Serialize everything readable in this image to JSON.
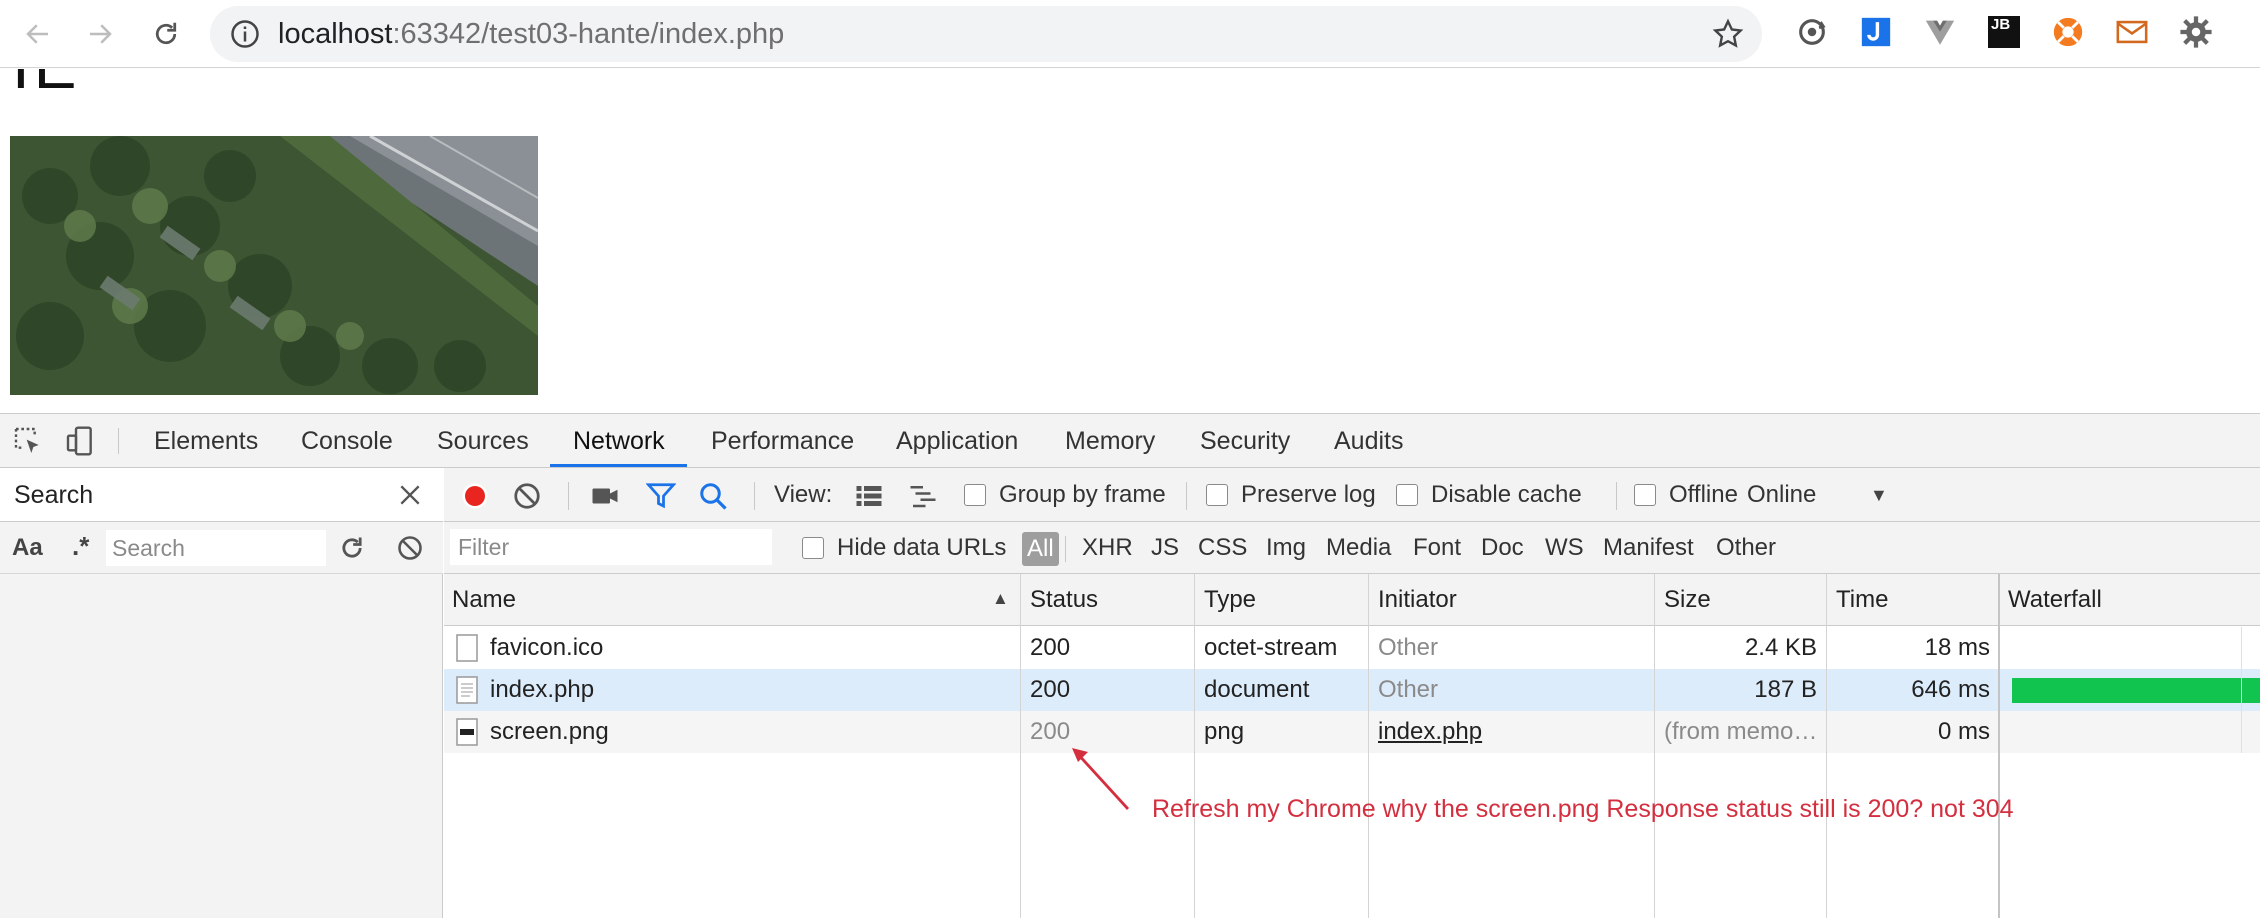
{
  "browser": {
    "url_host": "localhost",
    "url_rest": ":63342/test03-hante/index.php",
    "icons": [
      "back-arrow-icon",
      "forward-arrow-icon",
      "reload-icon",
      "info-icon",
      "star-icon"
    ],
    "extensions": [
      "sync-extension-icon",
      "blue-extension-icon",
      "vue-extension-icon",
      "jetbrains-extension-icon",
      "orange-extension-icon",
      "envelope-extension-icon",
      "gear-extension-icon"
    ],
    "extension_jb_label": "JB"
  },
  "page": {
    "heading_fragment": "IE"
  },
  "devtools": {
    "tabs": [
      "Elements",
      "Console",
      "Sources",
      "Network",
      "Performance",
      "Application",
      "Memory",
      "Security",
      "Audits"
    ],
    "active_tab": "Network",
    "search_drawer": {
      "title": "Search",
      "case_label": "Aa",
      "regex_label": ".*",
      "search_placeholder": "Search"
    },
    "network": {
      "view_label": "View:",
      "group_by_frame": "Group by frame",
      "preserve_log": "Preserve log",
      "disable_cache": "Disable cache",
      "offline": "Offline",
      "throttling": "Online",
      "filter_placeholder": "Filter",
      "hide_data_urls": "Hide data URLs",
      "filter_types": [
        "All",
        "XHR",
        "JS",
        "CSS",
        "Img",
        "Media",
        "Font",
        "Doc",
        "WS",
        "Manifest",
        "Other"
      ],
      "columns": [
        "Name",
        "Status",
        "Type",
        "Initiator",
        "Size",
        "Time",
        "Waterfall"
      ],
      "rows": [
        {
          "name": "favicon.ico",
          "status": "200",
          "type": "octet-stream",
          "initiator": "Other",
          "size": "2.4 KB",
          "time": "18 ms"
        },
        {
          "name": "index.php",
          "status": "200",
          "type": "document",
          "initiator": "Other",
          "size": "187 B",
          "time": "646 ms"
        },
        {
          "name": "screen.png",
          "status": "200",
          "type": "png",
          "initiator": "index.php",
          "size": "(from memo…",
          "time": "0 ms"
        }
      ]
    },
    "annotation": "Refresh my Chrome why the screen.png Response status still is 200? not 304",
    "colors": {
      "record": "#e8261f",
      "active_tab_underline": "#1a73e8",
      "filter_icon": "#1a73e8",
      "selected_row": "#ddecfb",
      "waterfall_bar": "#10c44f",
      "annotation": "#d32f3f"
    }
  }
}
